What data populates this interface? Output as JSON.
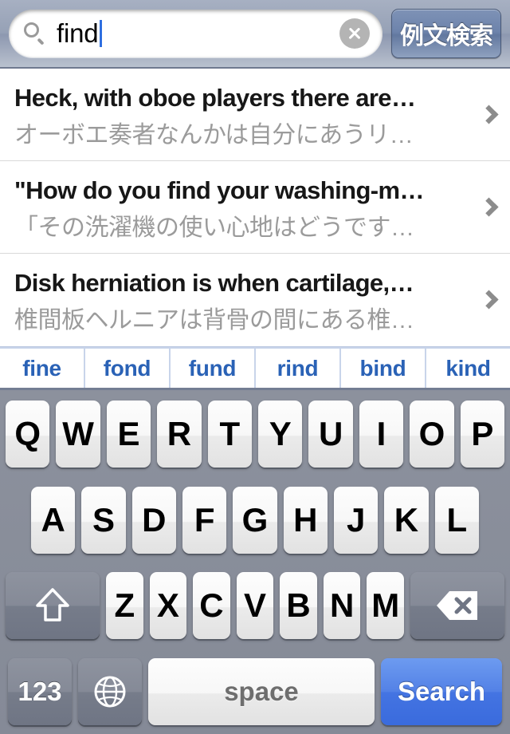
{
  "search": {
    "icon": "search-icon",
    "value": "find",
    "clear_icon": "clear-circle-icon",
    "example_button_label": "例文検索"
  },
  "results": [
    {
      "title": "Heck, with oboe players there are…",
      "subtitle": "オーボエ奏者なんかは自分にあうリ…",
      "accessory": "chevron-right-icon"
    },
    {
      "title": "\"How do you find your washing-m…",
      "subtitle": "「その洗濯機の使い心地はどうです…",
      "accessory": "chevron-right-icon"
    },
    {
      "title": "Disk herniation is when cartilage,…",
      "subtitle": "椎間板ヘルニアは背骨の間にある椎…",
      "accessory": "chevron-right-icon"
    }
  ],
  "suggestions": [
    "fine",
    "fond",
    "fund",
    "rind",
    "bind",
    "kind"
  ],
  "keyboard": {
    "row1": [
      "Q",
      "W",
      "E",
      "R",
      "T",
      "Y",
      "U",
      "I",
      "O",
      "P"
    ],
    "row2": [
      "A",
      "S",
      "D",
      "F",
      "G",
      "H",
      "J",
      "K",
      "L"
    ],
    "row3": [
      "Z",
      "X",
      "C",
      "V",
      "B",
      "N",
      "M"
    ],
    "shift_icon": "shift-arrow-icon",
    "delete_icon": "backspace-delete-icon",
    "numbers_label": "123",
    "globe_icon": "globe-language-icon",
    "space_label": "space",
    "search_label": "Search"
  },
  "colors": {
    "accent_blue": "#4474e2",
    "suggestion_text": "#2a62b6",
    "keyboard_bg": "#858a97",
    "searchbar_bg": "#96a1b6",
    "subtitle_gray": "#9b9b9b"
  }
}
